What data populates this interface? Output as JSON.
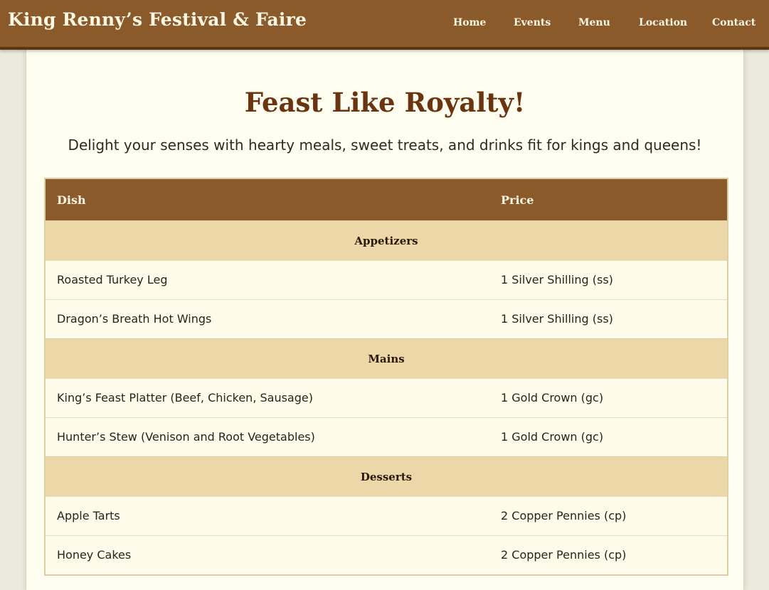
{
  "header": {
    "site_title": "King Renny’s Festival & Faire",
    "nav": [
      "Home",
      "Events",
      "Menu",
      "Location",
      "Contact"
    ]
  },
  "main": {
    "title": "Feast Like Royalty!",
    "intro": "Delight your senses with hearty meals, sweet treats, and drinks fit for kings and queens!"
  },
  "menu_table": {
    "columns": [
      "Dish",
      "Price"
    ],
    "sections": [
      {
        "category": "Appetizers",
        "items": [
          {
            "dish": "Roasted Turkey Leg",
            "price": "1 Silver Shilling (ss)"
          },
          {
            "dish": "Dragon’s Breath Hot Wings",
            "price": "1 Silver Shilling (ss)"
          }
        ]
      },
      {
        "category": "Mains",
        "items": [
          {
            "dish": "King’s Feast Platter (Beef, Chicken, Sausage)",
            "price": "1 Gold Crown (gc)"
          },
          {
            "dish": "Hunter’s Stew (Venison and Root Vegetables)",
            "price": "1 Gold Crown (gc)"
          }
        ]
      },
      {
        "category": "Desserts",
        "items": [
          {
            "dish": "Apple Tarts",
            "price": "2 Copper Pennies (cp)"
          },
          {
            "dish": "Honey Cakes",
            "price": "2 Copper Pennies (cp)"
          }
        ]
      }
    ]
  },
  "colors": {
    "header_brown": "#8b5a2b",
    "title_brown": "#6b3410",
    "category_tan": "#ebd7a7",
    "panel_cream": "#fffdef"
  }
}
